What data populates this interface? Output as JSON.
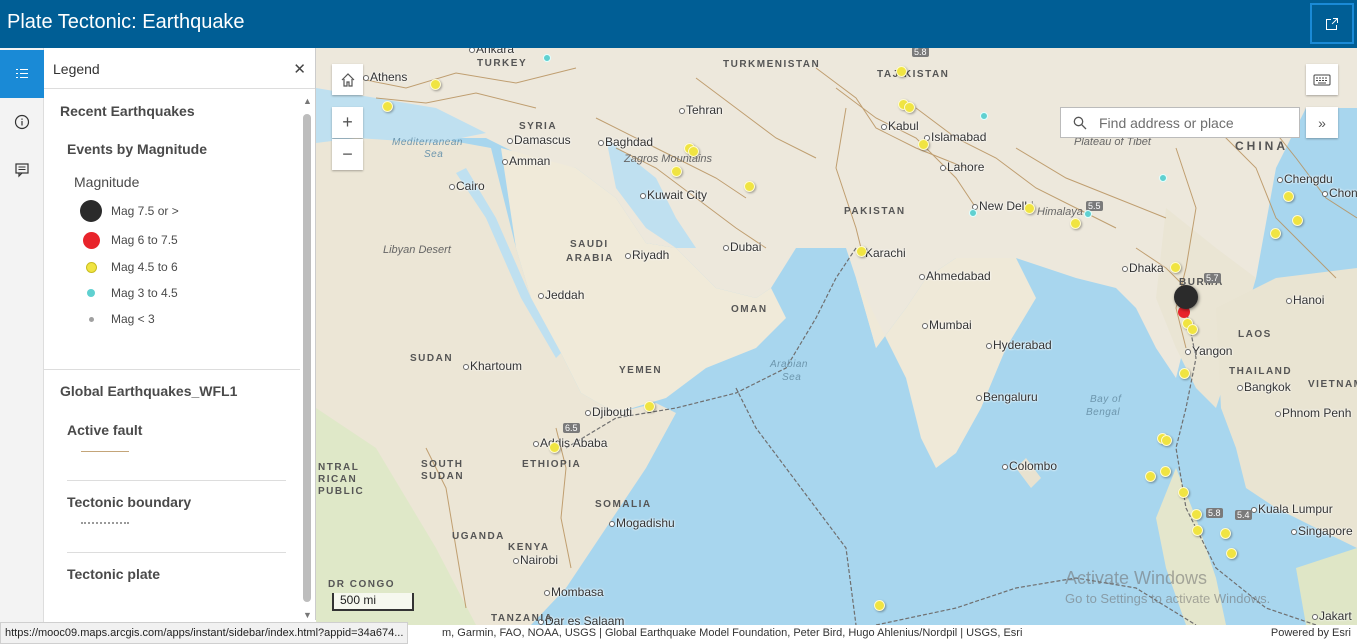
{
  "app": {
    "title": "Plate Tectonic: Earthquake"
  },
  "legend_panel": {
    "header": "Legend",
    "layers": [
      {
        "title": "Recent Earthquakes",
        "group": "Events by Magnitude",
        "field": "Magnitude",
        "items": [
          {
            "label": "Mag 7.5 or >",
            "color": "#2b2b2b"
          },
          {
            "label": "Mag 6 to 7.5",
            "color": "#e8242b"
          },
          {
            "label": "Mag 4.5 to 6",
            "color": "#f0e442"
          },
          {
            "label": "Mag 3 to 4.5",
            "color": "#5fd0d0"
          },
          {
            "label": "Mag < 3",
            "color": "#a0a0a0"
          }
        ]
      },
      {
        "title": "Global Earthquakes_WFL1",
        "groups": [
          "Active fault",
          "Tectonic boundary",
          "Tectonic plate"
        ]
      }
    ]
  },
  "map": {
    "search_placeholder": "Find address or place",
    "scale": "500 mi",
    "places": [
      "Athens",
      "Ankara",
      "Tehran",
      "Damascus",
      "Amman",
      "Baghdad",
      "Cairo",
      "Kuwait City",
      "Riyadh",
      "Dubai",
      "Jeddah",
      "Kabul",
      "Islamabad",
      "Lahore",
      "New Delhi",
      "Karachi",
      "Ahmedabad",
      "Mumbai",
      "Hyderabad",
      "Bengaluru",
      "Colombo",
      "Dhaka",
      "Yangon",
      "Bangkok",
      "Hanoi",
      "Phnom Penh",
      "Kuala Lumpur",
      "Singapore",
      "Chengdu",
      "Chongq",
      "Khartoum",
      "Djibouti",
      "Addis Ababa",
      "Mogadishu",
      "Nairobi",
      "Mombasa",
      "Dar es Salaam",
      "Jakart"
    ],
    "countries": [
      "TURKEY",
      "SYRIA",
      "TURKMENISTAN",
      "TAJIKISTAN",
      "SAUDI",
      "ARABIA",
      "OMAN",
      "PAKISTAN",
      "YEMEN",
      "SUDAN",
      "SOUTH",
      "SUDAN",
      "ETHIOPIA",
      "SOMALIA",
      "KENYA",
      "UGANDA",
      "TANZANIA",
      "DR CONGO",
      "CHINA",
      "BURMA",
      "LAOS",
      "THAILAND",
      "VIETNAM",
      "NTRAL",
      "RICAN",
      "PUBLIC"
    ],
    "water": [
      "Mediterranean",
      "Sea",
      "Arabian",
      "Sea",
      "Bay of",
      "Bengal"
    ],
    "regions": [
      "Libyan Desert",
      "Zagros Mountains",
      "Plateau of Tibet",
      "Himalaya"
    ],
    "shields": [
      "5.8",
      "5.5",
      "6.5",
      "5.7",
      "5.8",
      "5.4"
    ],
    "watermark": {
      "line1": "Activate Windows",
      "line2": "Go to Settings to activate Windows."
    }
  },
  "attribution": {
    "credits": "m, Garmin, FAO, NOAA, USGS | Global Earthquake Model Foundation, Peter Bird, Hugo Ahlenius/Nordpil | USGS, Esri",
    "powered": "Powered by Esri"
  },
  "status_url": "https://mooc09.maps.arcgis.com/apps/instant/sidebar/index.html?appid=34a674..."
}
